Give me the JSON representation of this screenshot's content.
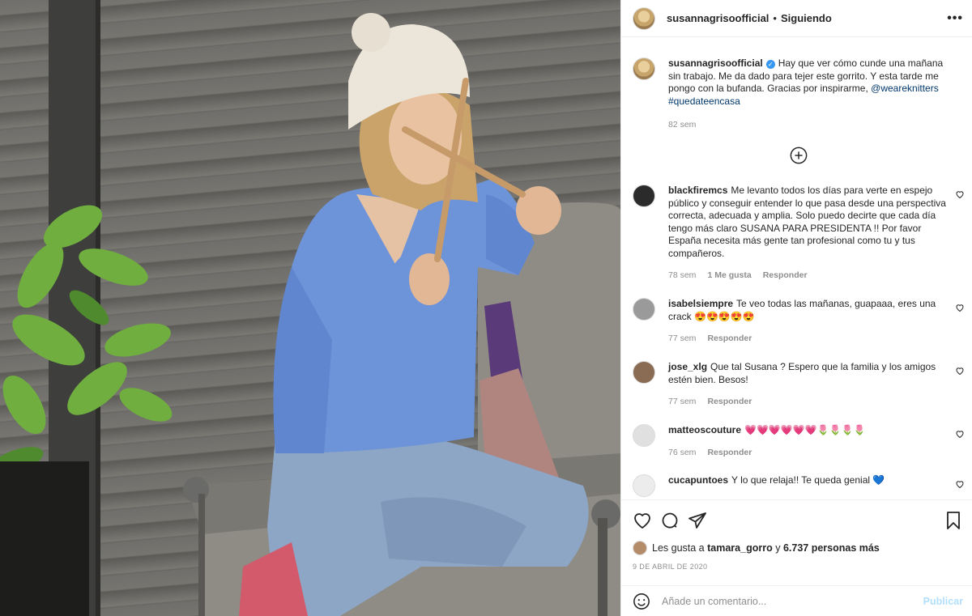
{
  "post": {
    "author": "susannagrisoofficial",
    "follow_status": "Siguiendo",
    "separator": "•",
    "more_icon": "more-horizontal-icon"
  },
  "caption": {
    "username": "susannagrisoofficial",
    "text": "Hay que ver cómo cunde una mañana sin trabajo. Me da dado para tejer este gorrito. Y esta tarde me pongo con la bufanda. Gracias por inspirarme,",
    "mention": "@weareknitters",
    "hashtag": "#quedateencasa",
    "time": "82 sem"
  },
  "comments": [
    {
      "username": "blackfiremcs",
      "text": "Me levanto todos los días para verte en espejo público y conseguir entender lo que pasa desde una perspectiva correcta, adecuada y amplia. Solo puedo decirte que cada día tengo más claro SUSANA PARA PRESIDENTA !! Por favor España necesita más gente tan profesional como tu y tus compañeros.",
      "time": "78 sem",
      "likes": "1 Me gusta",
      "reply": "Responder"
    },
    {
      "username": "isabelsiempre",
      "text": "Te veo todas las mañanas, guapaaa, eres una crack 😍😍😍😍😍",
      "time": "77 sem",
      "reply": "Responder"
    },
    {
      "username": "jose_xlg",
      "text": "Que tal Susana ? Espero que la familia y los amigos estén bien. Besos!",
      "time": "77 sem",
      "reply": "Responder"
    },
    {
      "username": "matteoscouture",
      "text": "💗💗💗💗💗💗🌷🌷🌷🌷",
      "time": "76 sem",
      "reply": "Responder"
    },
    {
      "username": "cucapuntoes",
      "text": "Y lo que relaja!! Te queda genial 💙"
    }
  ],
  "likes": {
    "prefix": "Les gusta a",
    "user": "tamara_gorro",
    "connector": "y",
    "others": "6.737 personas más"
  },
  "date": "9 DE ABRIL DE 2020",
  "add_comment": {
    "placeholder": "Añade un comentario...",
    "publish": "Publicar"
  },
  "icons": [
    "heart-icon",
    "comment-icon",
    "share-icon",
    "bookmark-icon",
    "emoji-icon",
    "add-circle-icon"
  ]
}
